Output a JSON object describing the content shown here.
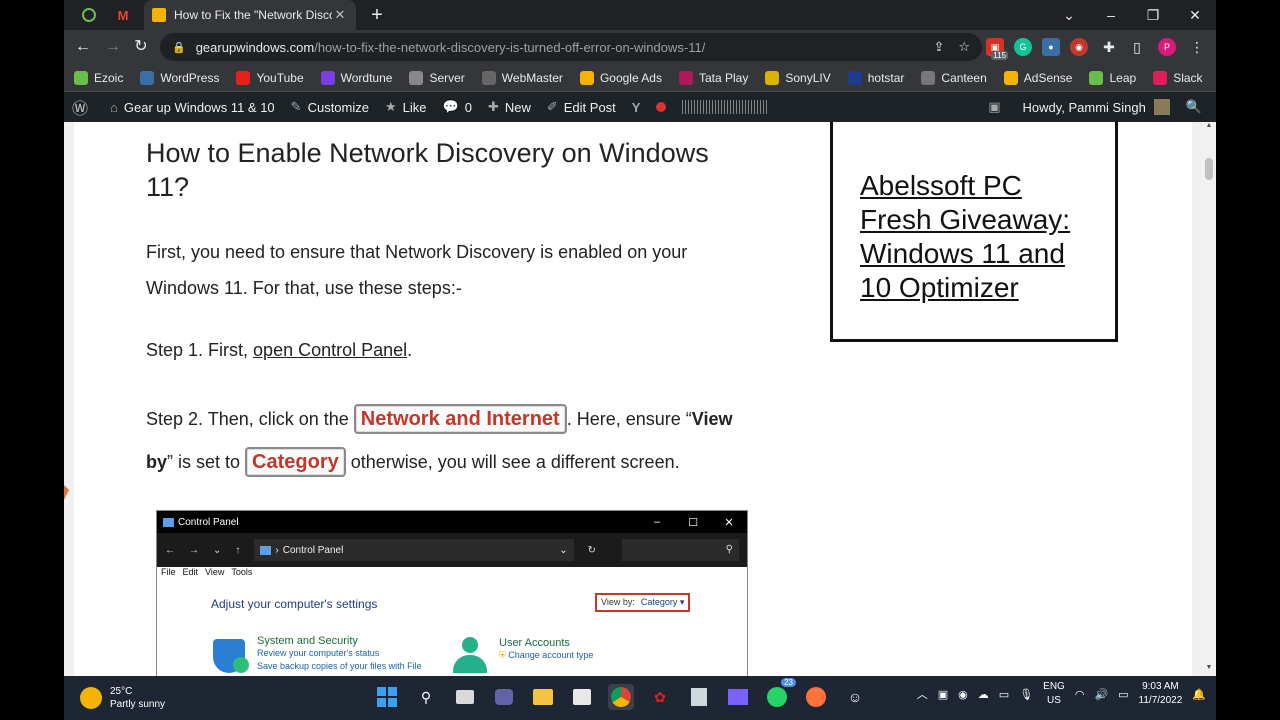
{
  "browser": {
    "tabs": [
      {
        "title": "How to Fix the \"Network Discove",
        "active": true
      }
    ],
    "window_controls": [
      "⌄",
      "–",
      "❐",
      "✕"
    ],
    "url_host": "gearupwindows.com",
    "url_path": "/how-to-fix-the-network-discovery-is-turned-off-error-on-windows-11/",
    "ext_badge": "115"
  },
  "bookmarks": [
    {
      "label": "Ezoic",
      "color": "#6abf4b"
    },
    {
      "label": "WordPress",
      "color": "#3a6ea5"
    },
    {
      "label": "YouTube",
      "color": "#e62117"
    },
    {
      "label": "Wordtune",
      "color": "#7b3fe4"
    },
    {
      "label": "Server",
      "color": "#888888"
    },
    {
      "label": "WebMaster",
      "color": "#666666"
    },
    {
      "label": "Google Ads",
      "color": "#f4b400"
    },
    {
      "label": "Tata Play",
      "color": "#b01a5a"
    },
    {
      "label": "SonyLIV",
      "color": "#d9b300"
    },
    {
      "label": "hotstar",
      "color": "#1f3b8f"
    },
    {
      "label": "Canteen",
      "color": "#777777"
    },
    {
      "label": "AdSense",
      "color": "#f4b400"
    },
    {
      "label": "Leap",
      "color": "#6abf4b"
    },
    {
      "label": "Slack",
      "color": "#e01e5a"
    }
  ],
  "wpbar": {
    "site": "Gear up Windows 11 & 10",
    "customize": "Customize",
    "like": "Like",
    "comments": "0",
    "new": "New",
    "edit": "Edit Post",
    "howdy": "Howdy, Pammi Singh"
  },
  "article": {
    "heading": "How to Enable Network Discovery on Windows 11?",
    "intro": "First, you need to ensure that Network Discovery is enabled on your Windows 11. For that, use these steps:-",
    "step1_prefix": "Step 1. First, ",
    "step1_link": "open Control Panel",
    "step1_suffix": ".",
    "step2_prefix": "Step 2. Then, click on the ",
    "step2_key1": "Network and Internet",
    "step2_mid": ". Here, ensure “",
    "step2_bold": "View by",
    "step2_mid2": "” is set to ",
    "step2_key2": "Category",
    "step2_suffix": " otherwise, you will see a different screen."
  },
  "sidebar": {
    "link": "Abelssoft PC Fresh Giveaway: Windows 11 and 10 Optimizer"
  },
  "control_panel": {
    "title": "Control Panel",
    "address": "Control Panel",
    "menu": [
      "File",
      "Edit",
      "View",
      "Tools"
    ],
    "adjust": "Adjust your computer's settings",
    "viewby_label": "View by:",
    "viewby_value": "Category ▾",
    "categories": [
      {
        "name": "System and Security",
        "subs": [
          "Review your computer's status",
          "Save backup copies of your files with File"
        ]
      },
      {
        "name": "User Accounts",
        "subs": [
          "Change account type"
        ]
      }
    ]
  },
  "taskbar": {
    "temp": "25°C",
    "weather": "Partly sunny",
    "lang1": "ENG",
    "lang2": "US",
    "time": "9:03 AM",
    "date": "11/7/2022",
    "badge": "23"
  }
}
